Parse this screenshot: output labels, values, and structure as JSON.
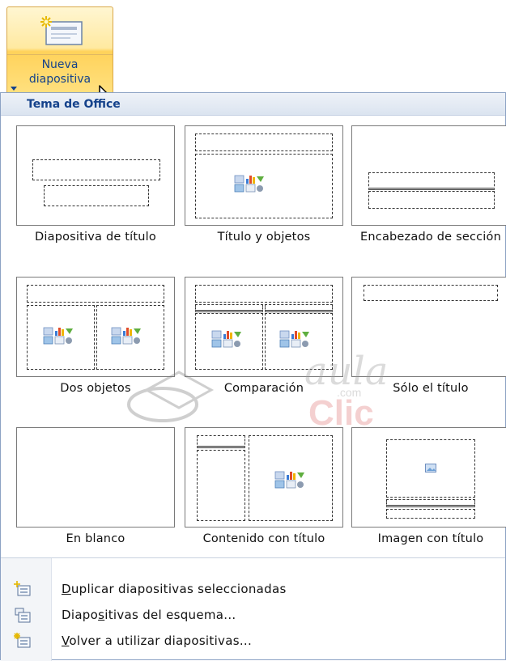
{
  "button": {
    "label_line1": "Nueva",
    "label_line2": "diapositiva"
  },
  "panel": {
    "theme_title": "Tema de Office",
    "layouts": [
      {
        "caption": "Diapositiva de título"
      },
      {
        "caption": "Título y objetos"
      },
      {
        "caption": "Encabezado de sección"
      },
      {
        "caption": "Dos objetos"
      },
      {
        "caption": "Comparación"
      },
      {
        "caption": "Sólo el título"
      },
      {
        "caption": "En blanco"
      },
      {
        "caption": "Contenido con título"
      },
      {
        "caption": "Imagen con título"
      }
    ]
  },
  "watermark": {
    "text1": "aula",
    "text2": "Clic",
    "text3": ".com"
  },
  "menu": {
    "items": [
      {
        "access_key": "D",
        "rest": "uplicar diapositivas seleccionadas",
        "pre": ""
      },
      {
        "pre": "Diapo",
        "access_key": "s",
        "rest": "itivas del esquema..."
      },
      {
        "access_key": "V",
        "rest": "olver a utilizar diapositivas...",
        "pre": ""
      }
    ]
  },
  "colors": {
    "accent": "#15428b",
    "button_fill": "#ffd25a"
  },
  "icons": [
    "new-slide-icon",
    "mouse-cursor-icon",
    "content-icon",
    "picture-icon",
    "duplicate-slides-icon",
    "outline-slides-icon",
    "reuse-slides-icon"
  ]
}
